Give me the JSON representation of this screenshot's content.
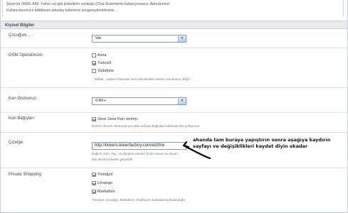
{
  "top_note": {
    "line1": "Şayet bir (MSN, AIM, Yahoo vs) gibi pinkellerin sunduğu (Chat Sistemlerini kullanıyorsanız, Adreslerinizi",
    "line2": "Kullanıcılarımızın bildiklerek arkadaş haberimiz zenginleştirebilirsiniz ..."
  },
  "section": {
    "title": "Kişisel Bilgiler"
  },
  "child": {
    "label": "Çocuğum ... :",
    "value": "Var",
    "arrow": "▼"
  },
  "gsm": {
    "label": "GSM Operatörüm:",
    "options": [
      {
        "label": "Avea",
        "checked": false
      },
      {
        "label": "Turkcell",
        "checked": true
      },
      {
        "label": "Vodafone",
        "checked": false
      }
    ],
    "hint": "Dikkat : sadece Operatör ismi istenilmekte telefon numaranız değil !"
  },
  "blood": {
    "label": "Kan Grubunuz:",
    "value": "0 Rh+",
    "arrow": "▼"
  },
  "donation": {
    "label": "Kan Bağışları:",
    "checkbox_label": "Seve Seve Kan veririm.",
    "checked": true,
    "hint": "Dönem dönem sitemizde yer alan acil kan bağışları hakkında ileti yolluyoruz."
  },
  "ticker": {
    "label": "Çizelge:",
    "value": "http://tickers.tickerfactory.com/ezt/t/w",
    "hint1": "Doğum, Kilo, Yaş, Yıl dönümü Hamile Ticker seven bu ölçüm",
    "hint2": "dan alınan tickerlar geçerlidir."
  },
  "annotation": {
    "line1": "ahanda tam buraya yapıştırın sonra aşağıya kaydırın",
    "line2": "sayfayı ve değişiklikleri kaydet diyin okadar"
  },
  "shopping": {
    "label": "Private Shopping:",
    "options": [
      {
        "label": "Trendyol",
        "checked": true
      },
      {
        "label": "Limango",
        "checked": true
      },
      {
        "label": "Markafoni",
        "checked": true
      }
    ],
    "hint": "Trendyol, Limango, Markafoni, Clubboom markalarının bulunduğu"
  }
}
